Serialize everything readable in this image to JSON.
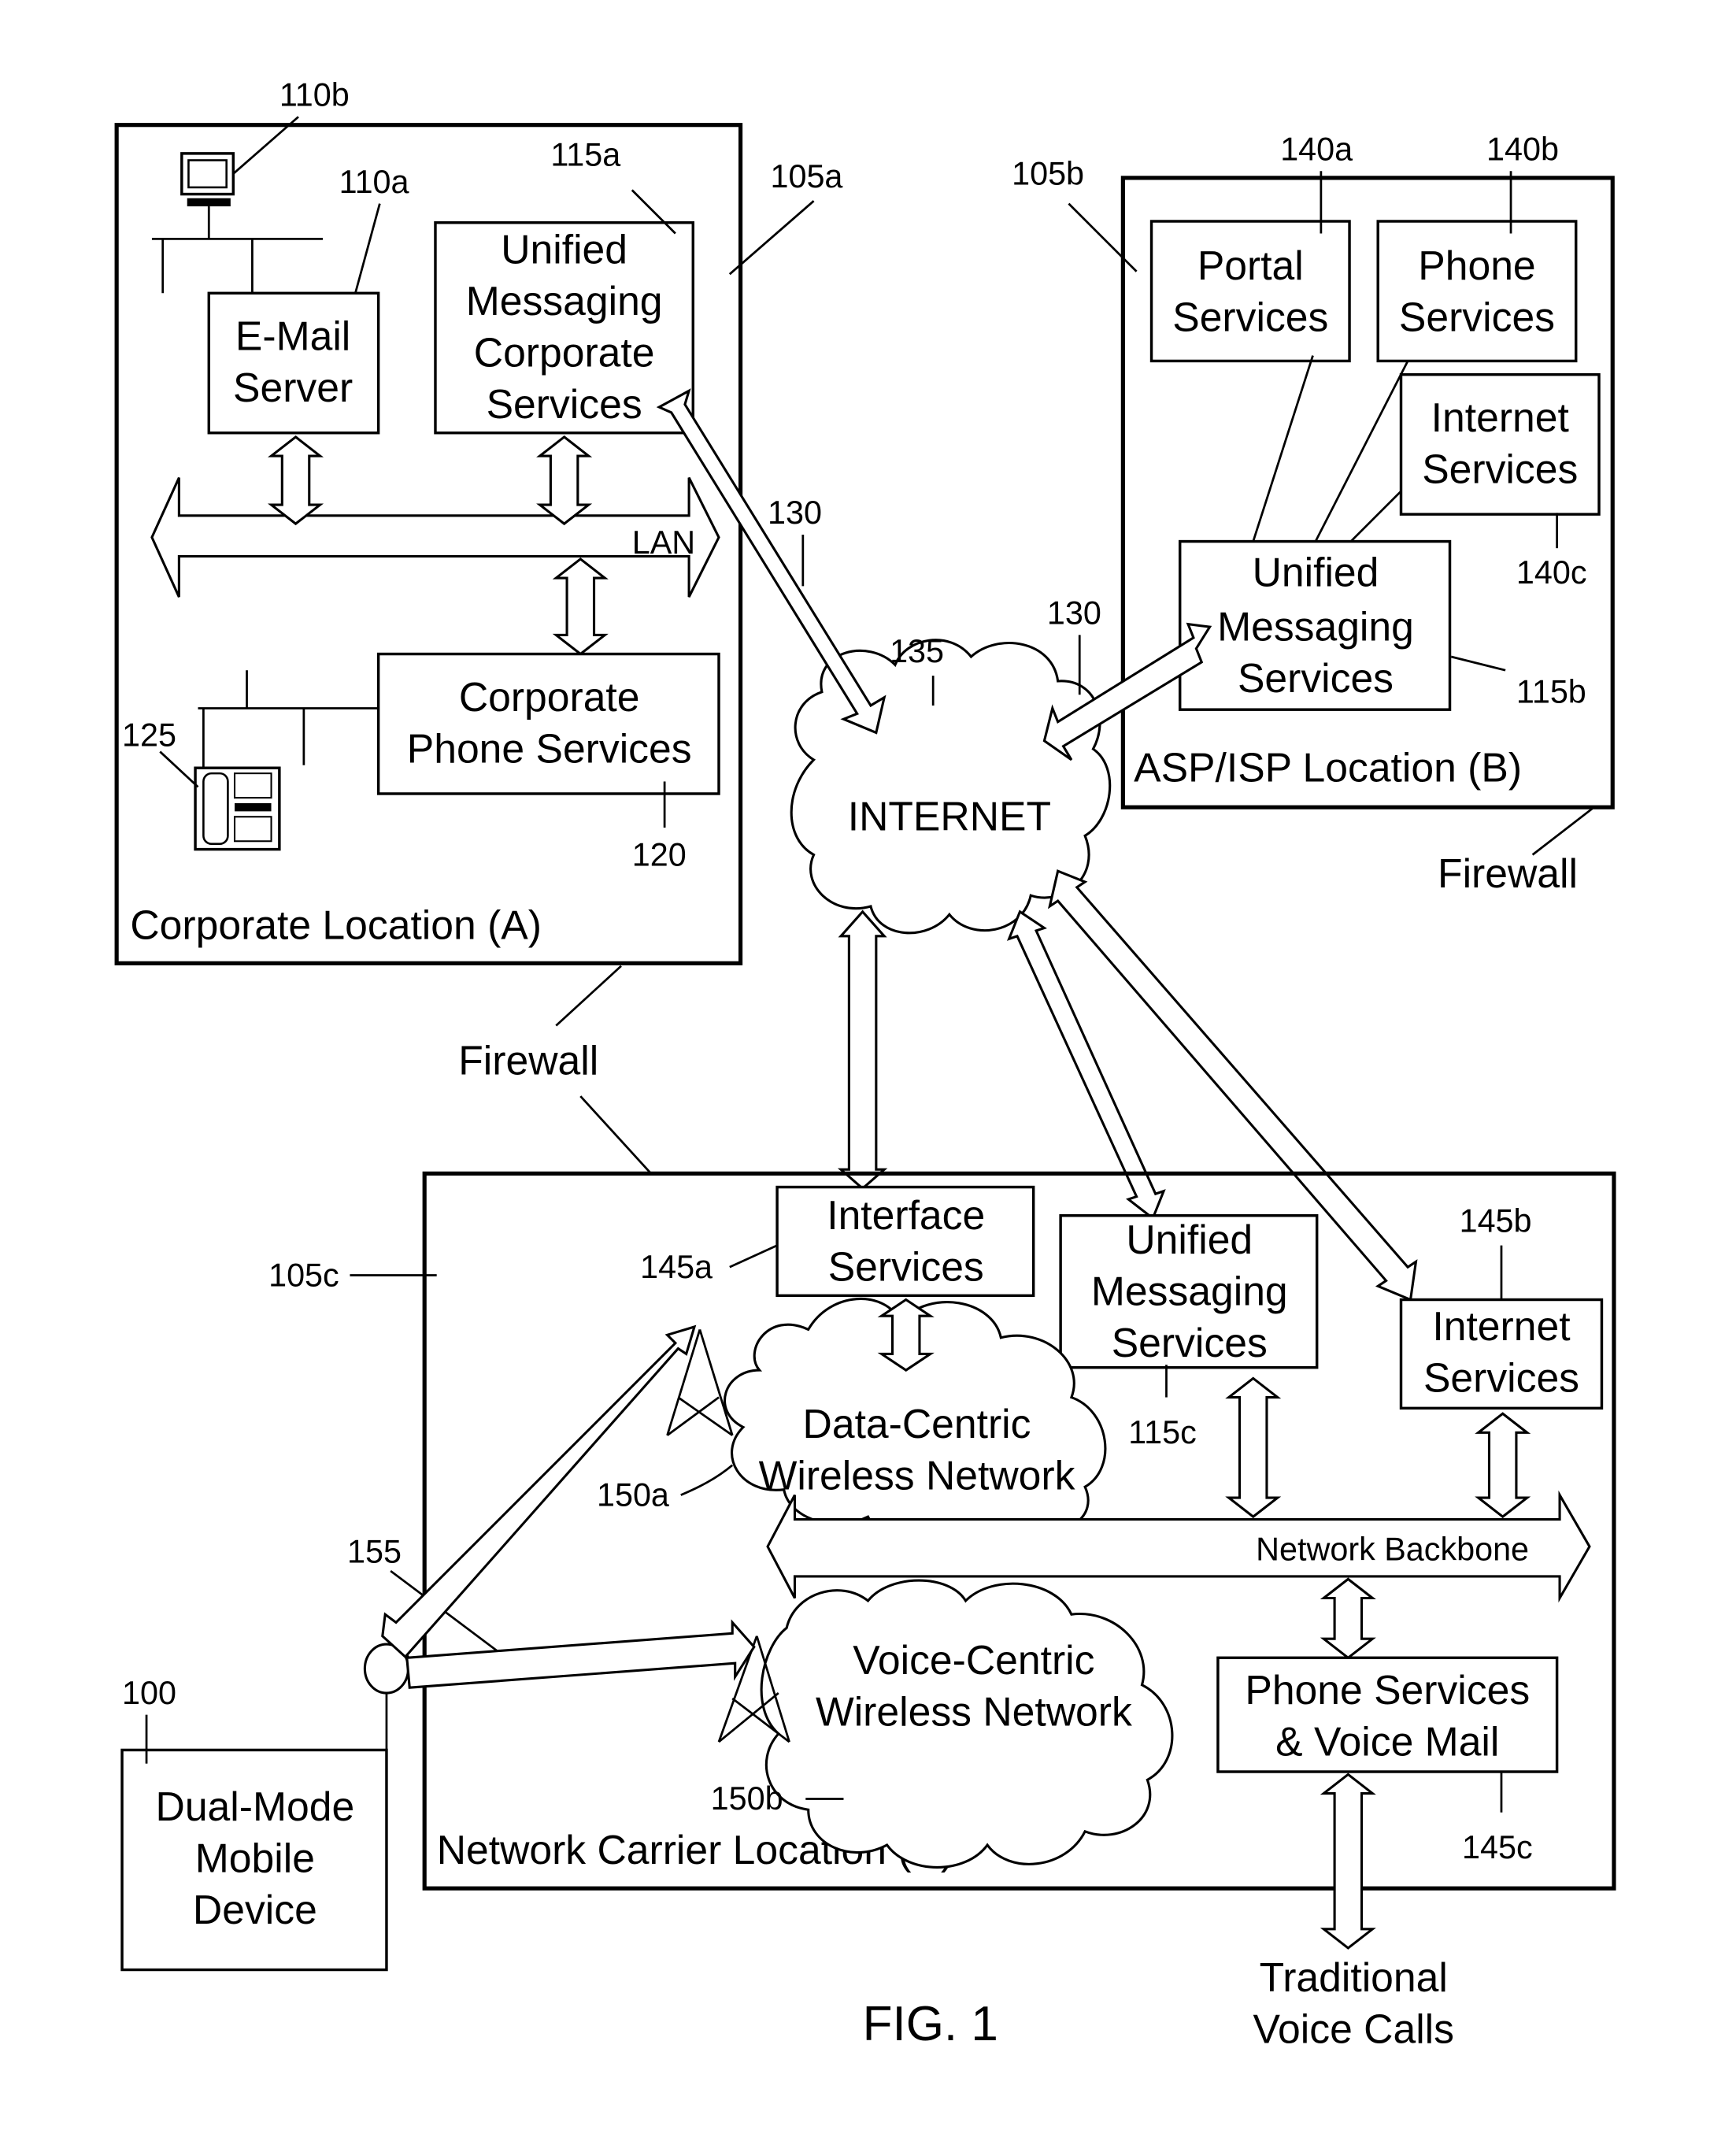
{
  "figure": {
    "caption": "FIG. 1",
    "colors": {
      "ink": "#000000",
      "paper": "#ffffff"
    }
  },
  "corporate": {
    "ref": "105a",
    "location_label": "Corporate Location (A)",
    "email_server": {
      "lines": [
        "E-Mail",
        "Server"
      ],
      "ref": "110a"
    },
    "workstation_ref": "110b",
    "um_corporate": {
      "lines": [
        "Unified",
        "Messaging",
        "Corporate",
        "Services"
      ],
      "ref": "115a"
    },
    "lan_label": "LAN",
    "phone_services": {
      "lines": [
        "Corporate",
        "Phone Services"
      ],
      "ref": "120"
    },
    "phone_ref": "125",
    "firewall_label": "Firewall"
  },
  "asp": {
    "ref": "105b",
    "location_label": "ASP/ISP Location (B)",
    "portal": {
      "lines": [
        "Portal",
        "Services"
      ],
      "ref": "140a"
    },
    "phone": {
      "lines": [
        "Phone",
        "Services"
      ],
      "ref": "140b"
    },
    "internet": {
      "lines": [
        "Internet",
        "Services"
      ],
      "ref": "140c"
    },
    "um": {
      "lines": [
        "Unified",
        "Messaging",
        "Services"
      ],
      "ref": "115b"
    },
    "firewall_label": "Firewall"
  },
  "internet": {
    "label": "INTERNET",
    "ref": "135",
    "link_ref_a": "130",
    "link_ref_b": "130"
  },
  "carrier": {
    "ref": "105c",
    "location_label": "Network Carrier Location (C)",
    "interface": {
      "lines": [
        "Interface",
        "Services"
      ],
      "ref": "145a"
    },
    "um": {
      "lines": [
        "Unified",
        "Messaging",
        "Services"
      ],
      "ref": "115c"
    },
    "internet": {
      "lines": [
        "Internet",
        "Services"
      ],
      "ref": "145b"
    },
    "data_network": {
      "lines": [
        "Data-Centric",
        "Wireless Network"
      ],
      "ref": "150a"
    },
    "voice_network": {
      "lines": [
        "Voice-Centric",
        "Wireless Network"
      ],
      "ref": "150b"
    },
    "backbone_label": "Network Backbone",
    "phone_vm": {
      "lines": [
        "Phone Services",
        "& Voice Mail"
      ],
      "ref": "145c"
    },
    "firewall_label": "Firewall"
  },
  "device": {
    "lines": [
      "Dual-Mode",
      "Mobile",
      "Device"
    ],
    "ref": "100",
    "antenna_ref": "155"
  },
  "voice_calls": {
    "lines": [
      "Traditional",
      "Voice Calls"
    ]
  }
}
